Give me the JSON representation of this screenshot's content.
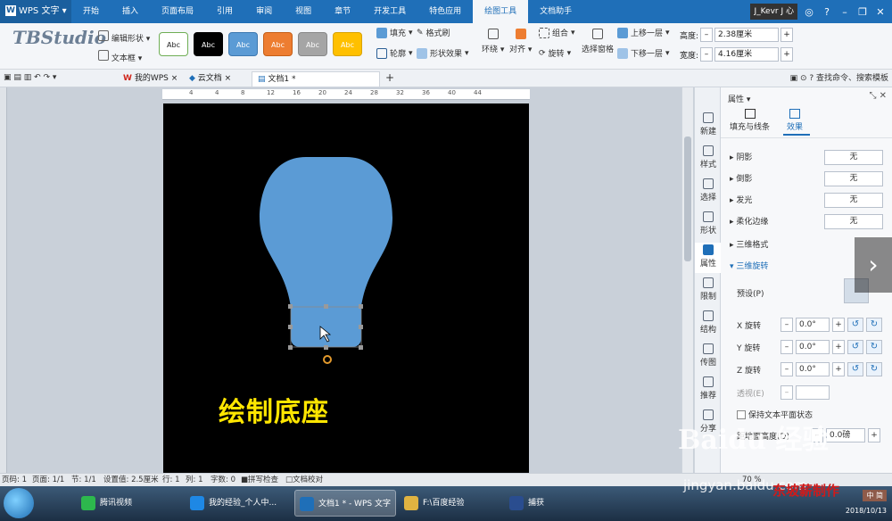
{
  "app": {
    "menu_label": "WPS 文字",
    "tabs": [
      "开始",
      "插入",
      "页面布局",
      "引用",
      "审阅",
      "视图",
      "章节",
      "开发工具",
      "特色应用",
      "绘图工具",
      "文档助手"
    ],
    "active_tab": "绘图工具",
    "user_label": "J_Kevr J 心"
  },
  "ribbon": {
    "logo_text": "TBStudio",
    "edit_shape": "编辑形状",
    "text_box": "文本框",
    "style_boxes": [
      {
        "label": "Abc",
        "bg": "#ffffff",
        "fg": "#222222",
        "border": "#6fae55"
      },
      {
        "label": "Abc",
        "bg": "#000000",
        "fg": "#ffffff",
        "border": "#000000"
      },
      {
        "label": "Abc",
        "bg": "#5b9bd5",
        "fg": "#ffffff",
        "border": "#3d78b0"
      },
      {
        "label": "Abc",
        "bg": "#ed7d31",
        "fg": "#ffffff",
        "border": "#c55f18"
      },
      {
        "label": "Abc",
        "bg": "#a5a5a5",
        "fg": "#ffffff",
        "border": "#888888"
      },
      {
        "label": "Abc",
        "bg": "#ffc000",
        "fg": "#ffffff",
        "border": "#d9a300"
      }
    ],
    "fill": "填充",
    "format_brush": "格式刷",
    "outline": "轮廓",
    "shape_effect": "形状效果",
    "wrap": "环绕",
    "align": "对齐",
    "group": "组合",
    "rotate": "旋转",
    "selection_pane": "选择窗格",
    "bring_forward": "上移一层",
    "send_backward": "下移一层",
    "height_label": "高度:",
    "height_value": "2.38厘米",
    "width_label": "宽度:",
    "width_value": "4.16厘米"
  },
  "docbar": {
    "tabs": [
      "我的WPS",
      "云文档",
      "文档1 *"
    ],
    "active": "文档1 *",
    "search_hint": "查找命令、搜索模板"
  },
  "ruler_ticks": [
    "4",
    "4",
    "8",
    "12",
    "16",
    "20",
    "24",
    "28",
    "32",
    "36",
    "40",
    "44"
  ],
  "canvas": {
    "caption": "绘制底座",
    "bulb_color": "#5b9bd5",
    "page_color": "#000000",
    "caption_color": "#ffe600"
  },
  "rail": [
    {
      "label": "新建",
      "icon": "new-icon"
    },
    {
      "label": "样式",
      "icon": "style-icon"
    },
    {
      "label": "选择",
      "icon": "select-icon"
    },
    {
      "label": "形状",
      "icon": "shape-icon"
    },
    {
      "label": "属性",
      "icon": "property-icon",
      "active": true
    },
    {
      "label": "限制",
      "icon": "restrict-icon"
    },
    {
      "label": "结构",
      "icon": "structure-icon"
    },
    {
      "label": "传图",
      "icon": "image-icon"
    },
    {
      "label": "推荐",
      "icon": "recommend-icon"
    },
    {
      "label": "分享",
      "icon": "share-icon"
    }
  ],
  "panel": {
    "title": "属性",
    "tab_fill": "填充与线条",
    "tab_effect": "效果",
    "sections": [
      {
        "label": "阴影",
        "value": "无"
      },
      {
        "label": "倒影",
        "value": "无"
      },
      {
        "label": "发光",
        "value": "无"
      },
      {
        "label": "柔化边缘",
        "value": "无"
      }
    ],
    "section_3d_format": "三维格式",
    "section_3d_rotate": "三维旋转",
    "preset_label": "预设(P)",
    "x_rot_label": "X 旋转",
    "x_rot_value": "0.0°",
    "y_rot_label": "Y 旋转",
    "y_rot_value": "0.0°",
    "z_rot_label": "Z 旋转",
    "z_rot_value": "0.0°",
    "perspective_label": "透视(E)",
    "keep_flat_label": "保持文本平面状态",
    "distance_label": "距地面高度(D)",
    "distance_value": "0.0磅"
  },
  "statusbar": {
    "page_num": "页码: 1",
    "pages": "页面: 1/1",
    "section": "节: 1/1",
    "setting": "设置值: 2.5厘米",
    "row": "行: 1",
    "col": "列: 1",
    "words": "字数: 0",
    "spell": "拼写检查",
    "proof": "文档校对",
    "zoom": "70 %"
  },
  "taskbar": {
    "items": [
      {
        "label": "腾讯视频",
        "color": "#2db84d"
      },
      {
        "label": "我的经验_个人中...",
        "color": "#1e88e5"
      },
      {
        "label": "文档1 * - WPS 文字",
        "color": "#1f6fb8",
        "active": true
      },
      {
        "label": "F:\\百度经验",
        "color": "#e0b341"
      },
      {
        "label": "捕获",
        "color": "#2a4d8f"
      }
    ],
    "ime": "中 简",
    "date": "2018/10/13"
  },
  "watermark": {
    "text": "Baidu 经验",
    "url": "jingyan.baidu.com",
    "stamp": "东坡薪制作"
  }
}
